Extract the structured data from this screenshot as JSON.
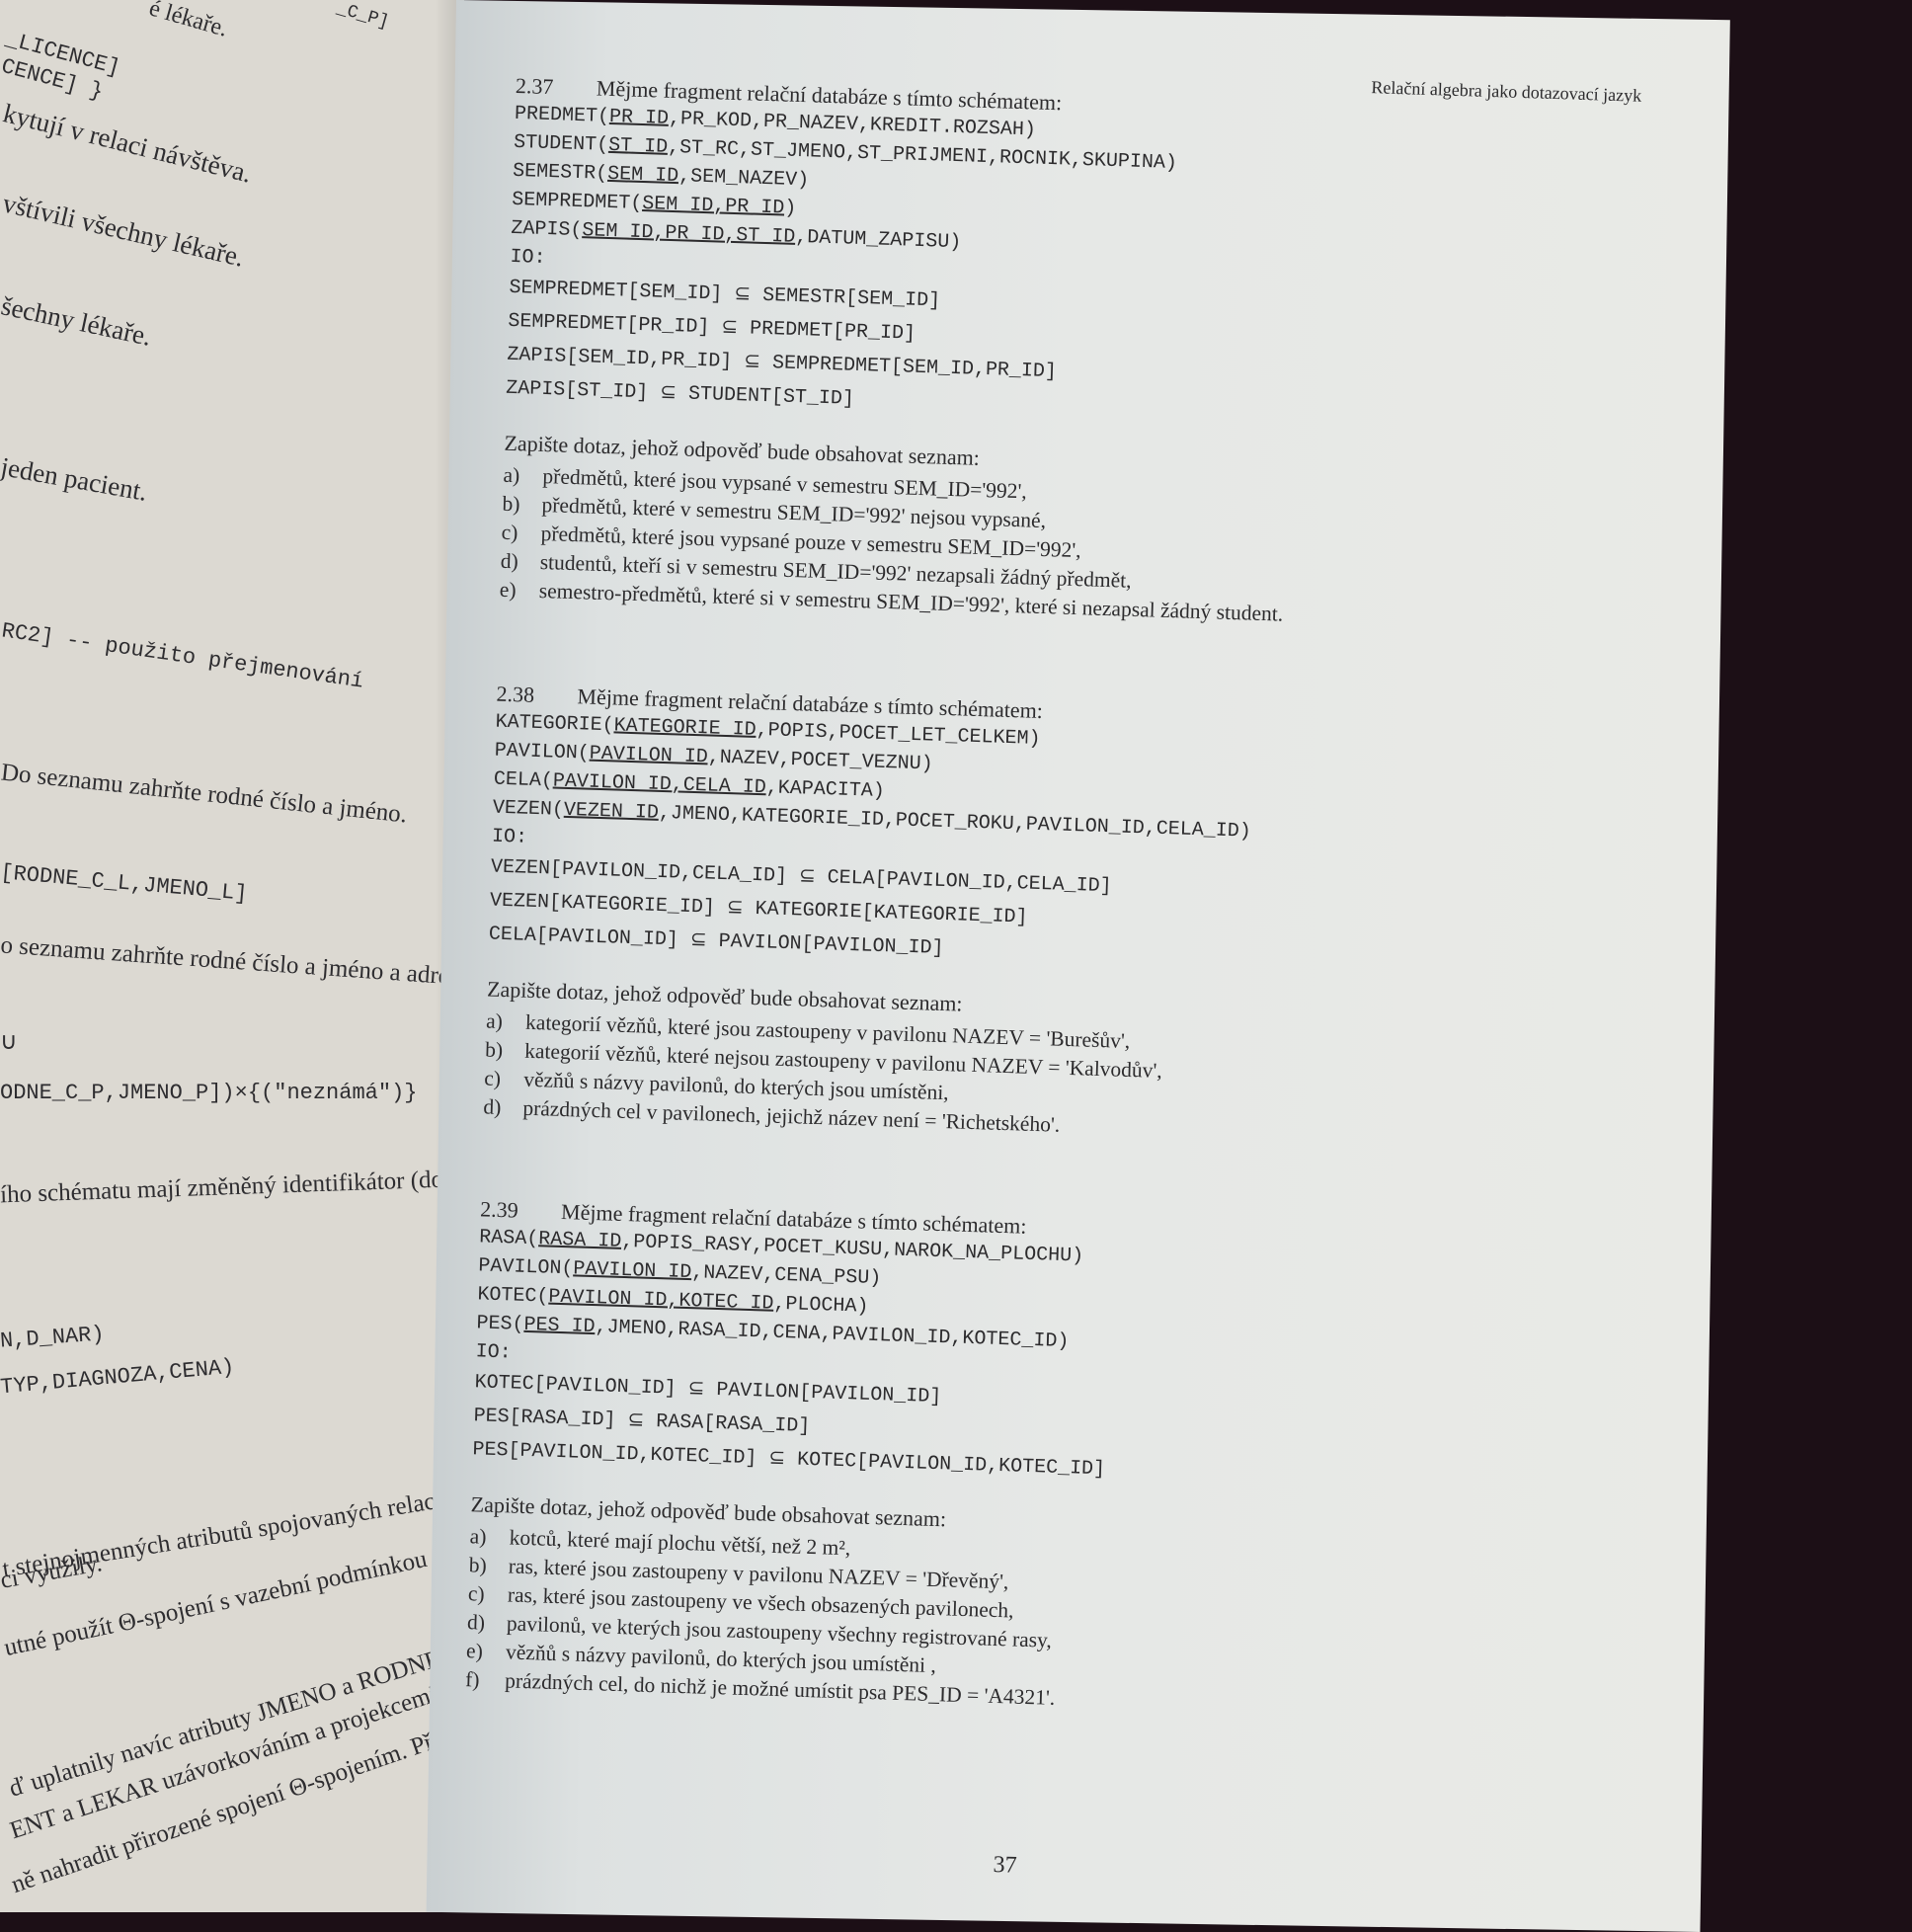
{
  "left_page": {
    "lines": [
      "é lékaře.",
      "_C_P]",
      "_LICENCE]",
      "CENCE] }",
      "kytují v relaci návštěva.",
      "vštívili všechny lékaře.",
      "šechny lékaře.",
      "jeden pacient.",
      "RC2]   -- použito přejmenování",
      "Do seznamu zahrňte rodné číslo a jméno.",
      "[RODNE_C_L,JMENO_L]",
      "o seznamu zahrňte rodné číslo a jméno a adresu",
      "∪",
      "ODNE_C_P,JMENO_P])×{(\"neznámá\")}",
      "ího schématu mají změněný identifikátor (dotče",
      "N,D_NAR)",
      "TYP,DIAGNOZA,CENA)",
      "t stejnojmenných atributů spojovaných relací.",
      "ci využily.",
      "utné použít Θ-spojení s vazební podmínkou",
      "ď uplatnily navíc atributy JMENO a RODNE_",
      "ENT a LEKAR uzávorkováním a projekcemi,",
      "ně nahradit přirozené spojení Θ-spojením. Pří-"
    ]
  },
  "header": "Relační algebra jako dotazovací jazyk",
  "exercises": [
    {
      "number": "2.37",
      "intro": "Mějme fragment relační databáze s tímto schématem:",
      "schema": [
        {
          "rel": "PREDMET",
          "pk": "PR_ID",
          "rest": ",PR_KOD,PR_NAZEV,KREDIT.ROZSAH)"
        },
        {
          "rel": "STUDENT",
          "pk": "ST_ID",
          "rest": ",ST_RC,ST_JMENO,ST_PRIJMENI,ROCNIK,SKUPINA)"
        },
        {
          "rel": "SEMESTR",
          "pk": "SEM_ID",
          "rest": ",SEM_NAZEV)"
        },
        {
          "rel": "SEMPREDMET",
          "pk": "SEM_ID,PR_ID",
          "rest": ")"
        },
        {
          "rel": "ZAPIS",
          "pk": "SEM_ID,PR_ID,ST_ID",
          "rest": ",DATUM_ZAPISU)"
        }
      ],
      "io_label": "IO:",
      "constraints": [
        "SEMPREDMET[SEM_ID] ⊆ SEMESTR[SEM_ID]",
        "SEMPREDMET[PR_ID] ⊆ PREDMET[PR_ID]",
        "ZAPIS[SEM_ID,PR_ID] ⊆ SEMPREDMET[SEM_ID,PR_ID]",
        "ZAPIS[ST_ID] ⊆ STUDENT[ST_ID]"
      ],
      "question": "Zapište dotaz, jehož odpověď bude obsahovat seznam:",
      "items": [
        {
          "label": "a)",
          "text": "předmětů, které jsou vypsané v semestru SEM_ID='992',"
        },
        {
          "label": "b)",
          "text": "předmětů, které v semestru SEM_ID='992' nejsou vypsané,"
        },
        {
          "label": "c)",
          "text": "předmětů, které jsou vypsané pouze v semestru SEM_ID='992',"
        },
        {
          "label": "d)",
          "text": "studentů, kteří si v semestru SEM_ID='992' nezapsali žádný předmět,"
        },
        {
          "label": "e)",
          "text": "semestro-předmětů, které si v semestru SEM_ID='992', které si nezapsal žádný student."
        }
      ]
    },
    {
      "number": "2.38",
      "intro": "Mějme fragment relační databáze s tímto schématem:",
      "schema": [
        {
          "rel": "KATEGORIE",
          "pk": "KATEGORIE_ID",
          "rest": ",POPIS,POCET_LET_CELKEM)"
        },
        {
          "rel": "PAVILON",
          "pk": "PAVILON_ID",
          "rest": ",NAZEV,POCET_VEZNU)"
        },
        {
          "rel": "CELA",
          "pk": "PAVILON_ID,CELA_ID",
          "rest": ",KAPACITA)"
        },
        {
          "rel": "VEZEN",
          "pk": "VEZEN_ID",
          "rest": ",JMENO,KATEGORIE_ID,POCET_ROKU,PAVILON_ID,CELA_ID)"
        }
      ],
      "io_label": "IO:",
      "constraints": [
        "VEZEN[PAVILON_ID,CELA_ID] ⊆ CELA[PAVILON_ID,CELA_ID]",
        "VEZEN[KATEGORIE_ID] ⊆ KATEGORIE[KATEGORIE_ID]",
        "CELA[PAVILON_ID] ⊆ PAVILON[PAVILON_ID]"
      ],
      "question": "Zapište dotaz, jehož odpověď bude obsahovat seznam:",
      "items": [
        {
          "label": "a)",
          "text": "kategorií vězňů, které jsou zastoupeny v pavilonu NAZEV = 'Burešův',"
        },
        {
          "label": "b)",
          "text": "kategorií vězňů, které nejsou zastoupeny v pavilonu NAZEV = 'Kalvodův',"
        },
        {
          "label": "c)",
          "text": "vězňů s názvy pavilonů, do kterých jsou umístěni,"
        },
        {
          "label": "d)",
          "text": "prázdných cel v pavilonech, jejichž název není = 'Richetského'."
        }
      ]
    },
    {
      "number": "2.39",
      "intro": "Mějme fragment relační databáze s tímto schématem:",
      "schema": [
        {
          "rel": "RASA",
          "pk": "RASA_ID",
          "rest": ",POPIS_RASY,POCET_KUSU,NAROK_NA_PLOCHU)"
        },
        {
          "rel": "PAVILON",
          "pk": "PAVILON_ID",
          "rest": ",NAZEV,CENA_PSU)"
        },
        {
          "rel": "KOTEC",
          "pk": "PAVILON_ID,KOTEC_ID",
          "rest": ",PLOCHA)"
        },
        {
          "rel": "PES",
          "pk": "PES_ID",
          "rest": ",JMENO,RASA_ID,CENA,PAVILON_ID,KOTEC_ID)"
        }
      ],
      "io_label": "IO:",
      "constraints": [
        "KOTEC[PAVILON_ID] ⊆ PAVILON[PAVILON_ID]",
        "PES[RASA_ID] ⊆ RASA[RASA_ID]",
        "PES[PAVILON_ID,KOTEC_ID] ⊆ KOTEC[PAVILON_ID,KOTEC_ID]"
      ],
      "question": "Zapište dotaz, jehož odpověď bude obsahovat seznam:",
      "items": [
        {
          "label": "a)",
          "text": "kotců, které mají plochu větší, než 2 m²,"
        },
        {
          "label": "b)",
          "text": "ras, které jsou zastoupeny v pavilonu NAZEV = 'Dřevěný',"
        },
        {
          "label": "c)",
          "text": "ras, které jsou zastoupeny ve všech obsazených pavilonech,"
        },
        {
          "label": "d)",
          "text": "pavilonů, ve kterých jsou zastoupeny všechny registrované rasy,"
        },
        {
          "label": "e)",
          "text": "vězňů s názvy pavilonů, do kterých jsou umístěni ,"
        },
        {
          "label": "f)",
          "text": "prázdných cel, do nichž je možné umístit psa PES_ID = 'A4321'."
        }
      ]
    }
  ],
  "page_number": "37"
}
